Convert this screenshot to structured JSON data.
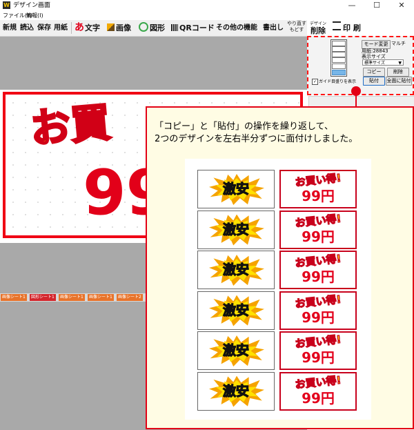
{
  "window": {
    "title": "デザイン画面",
    "app_icon": "W",
    "controls": {
      "minimize": "—",
      "maximize": "☐",
      "close": "✕"
    }
  },
  "menu": [
    "ファイル(F)",
    "情報(I)"
  ],
  "toolbar": {
    "new": "新規",
    "load": "読込",
    "save": "保存",
    "paper": "用紙",
    "text": "文字",
    "text_icon": "あ",
    "image": "画像",
    "shape": "図形",
    "qr": "QRコード",
    "other": "その他の機能",
    "output": "書出し",
    "redo": "やり直す",
    "undo": "もどす",
    "delete_top": "デザイン",
    "delete": "削除",
    "print": "印 刷"
  },
  "canvas": {
    "headline": "お買",
    "price": "99"
  },
  "sheet_tabs": [
    "画像シート1",
    "図形シート1",
    "画像シート1",
    "画像シート1",
    "画像シート2"
  ],
  "panel": {
    "mode_button": "モード変更",
    "multi": "マルチ",
    "paper_label": "用紙:28843",
    "display_size_label": "表示サイズ",
    "display_size_value": "標準サイズ",
    "copy": "コピー",
    "delete": "削除",
    "paste": "貼付",
    "paste_all": "全面に貼付",
    "guide_label": "ガイド目盛りを表示",
    "guide_checked": "✓"
  },
  "callout": {
    "line1": "「コピー」と「貼付」の操作を繰り返して、",
    "line2": "2つのデザインを左右半分ずつに面付けしました。"
  },
  "example": {
    "left_text": "激安",
    "right_head": "お買い得!",
    "right_price": "99円",
    "rows": 6
  },
  "colors": {
    "accent_red": "#e30015",
    "callout_bg": "#fffce4",
    "canvas_gray": "#a9a9a9"
  }
}
